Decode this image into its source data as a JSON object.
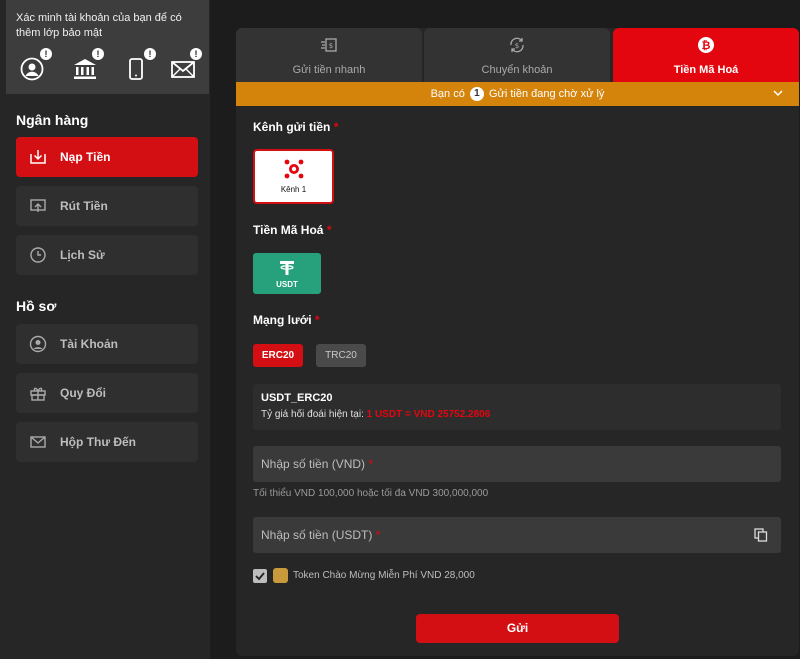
{
  "sidebar": {
    "verify_text": "Xác minh tài khoản của bạn để có thêm lớp bảo mật",
    "verify_icons": [
      {
        "icon": "user-icon",
        "badge": "!"
      },
      {
        "icon": "bank-icon",
        "badge": "!"
      },
      {
        "icon": "phone-icon",
        "badge": "!"
      },
      {
        "icon": "mail-icon",
        "badge": "!"
      }
    ],
    "bank_section": "Ngân hàng",
    "bank_items": [
      {
        "label": "Nạp Tiền",
        "icon": "deposit-icon",
        "active": true
      },
      {
        "label": "Rút Tiền",
        "icon": "withdraw-icon",
        "active": false
      },
      {
        "label": "Lịch Sử",
        "icon": "clock-icon",
        "active": false
      }
    ],
    "profile_section": "Hồ sơ",
    "profile_items": [
      {
        "label": "Tài Khoản",
        "icon": "account-icon"
      },
      {
        "label": "Quy Đổi",
        "icon": "gift-icon"
      },
      {
        "label": "Hộp Thư Đến",
        "icon": "inbox-icon"
      }
    ]
  },
  "tabs": [
    {
      "label": "Gửi tiền nhanh",
      "icon": "fast-deposit-icon",
      "active": false
    },
    {
      "label": "Chuyển khoản",
      "icon": "transfer-icon",
      "active": false
    },
    {
      "label": "Tiền Mã Hoá",
      "icon": "bitcoin-icon",
      "active": true
    }
  ],
  "pending": {
    "prefix": "Bạn có",
    "count": "1",
    "suffix": "Gửi tiền đang chờ xử lý"
  },
  "form": {
    "channel_label": "Kênh gửi tiền",
    "channel_option": "Kênh 1",
    "crypto_label": "Tiền Mã Hoá",
    "crypto_option": "USDT",
    "network_label": "Mạng lưới",
    "networks": [
      "ERC20",
      "TRC20"
    ],
    "selected_network": "ERC20",
    "info_title": "USDT_ERC20",
    "rate_label": "Tỷ giá hối đoái hiện tại:",
    "rate_value": "1 USDT = VND 25752.2806",
    "vnd_placeholder": "Nhập số tiền (VND)",
    "vnd_hint": "Tối thiểu VND 100,000 hoặc tối đa VND 300,000,000",
    "usdt_placeholder": "Nhập số tiền (USDT)",
    "promo_label": "Token Chào Mừng Miễn Phí VND 28,000",
    "promo_checked": true,
    "submit_label": "Gửi"
  },
  "colors": {
    "accent": "#d40f14",
    "warning": "#d4840a",
    "usdt": "#26a17b"
  }
}
